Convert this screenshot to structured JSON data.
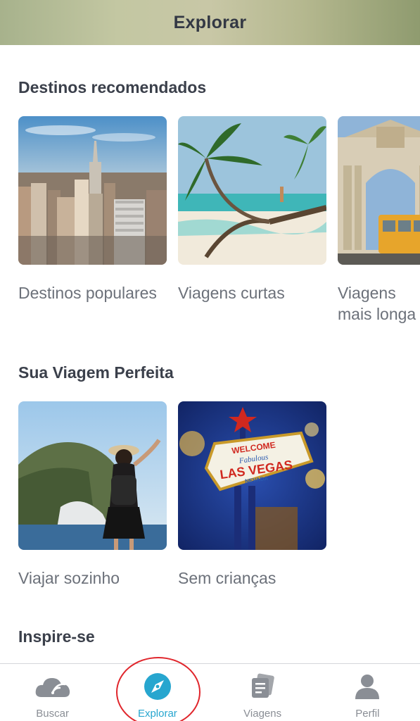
{
  "header": {
    "title": "Explorar"
  },
  "sections": {
    "recommended": {
      "title": "Destinos recomendados",
      "cards": [
        {
          "label": "Destinos populares",
          "image": "new-york-skyline"
        },
        {
          "label": "Viagens curtas",
          "image": "tropical-beach-palm"
        },
        {
          "label": "Viagens mais longa",
          "image": "european-arch-tram"
        }
      ]
    },
    "perfect_trip": {
      "title": "Sua Viagem Perfeita",
      "cards": [
        {
          "label": "Viajar sozinho",
          "image": "solo-traveler-coast"
        },
        {
          "label": "Sem crianças",
          "image": "las-vegas-sign"
        }
      ]
    },
    "inspire": {
      "title": "Inspire-se"
    }
  },
  "tabbar": {
    "items": [
      {
        "label": "Buscar",
        "icon": "cloud-wifi-icon",
        "active": false
      },
      {
        "label": "Explorar",
        "icon": "compass-icon",
        "active": true
      },
      {
        "label": "Viagens",
        "icon": "tickets-icon",
        "active": false
      },
      {
        "label": "Perfil",
        "icon": "person-icon",
        "active": false
      }
    ]
  },
  "colors": {
    "accent": "#27a6cf",
    "annotation_circle": "#e0262c",
    "tab_inactive": "#8a8e95",
    "caption": "#6c717a"
  }
}
